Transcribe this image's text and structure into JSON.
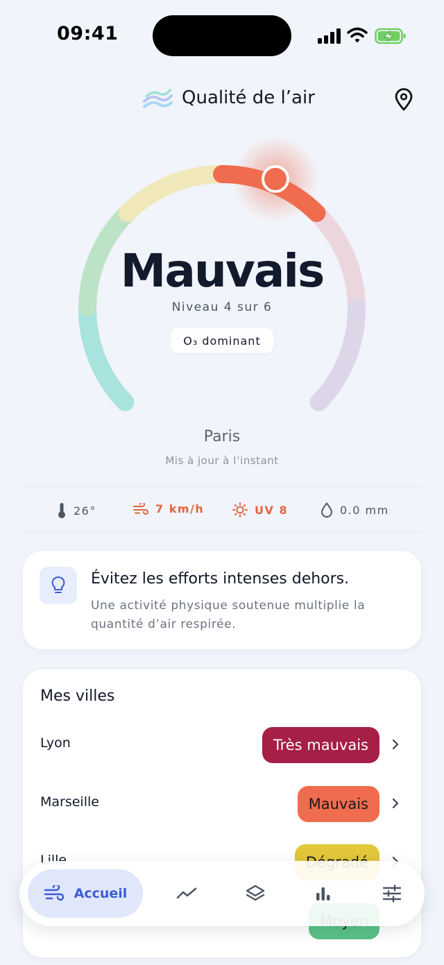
{
  "status_bar": {
    "time": "09:41"
  },
  "header": {
    "title": "Qualité de l’air"
  },
  "gauge": {
    "status": "Mauvais",
    "level_text": "Niveau 4 sur 6",
    "level": 4,
    "levels_total": 6,
    "pollutant_chip": "O₃ dominant",
    "segment_colors": [
      "#a9e3dd",
      "#bde3c7",
      "#f0e8b8",
      "#ef6c4e",
      "#ecd6de",
      "#ddd6e8"
    ],
    "accent": "#ef6c4e"
  },
  "location": {
    "city": "Paris",
    "updated": "Mis à jour à l’instant"
  },
  "weather": {
    "temperature": "26°",
    "wind": "7 km/h",
    "uv": "UV 8",
    "rain": "0.0 mm",
    "alert_color": "#e2643f"
  },
  "tip": {
    "title": "Évitez les efforts intenses dehors.",
    "body": "Une activité physique soutenue multiplie la quantité d’air respirée."
  },
  "cities": {
    "title": "Mes villes",
    "items": [
      {
        "name": "Lyon",
        "status": "Très mauvais",
        "color": "#a51f47",
        "text_color": "#ffffff"
      },
      {
        "name": "Marseille",
        "status": "Mauvais",
        "color": "#ef6c4e",
        "text_color": "#1a1a1a"
      },
      {
        "name": "Lille",
        "status": "Dégradé",
        "color": "#e3c73a",
        "text_color": "#1a1a1a"
      },
      {
        "name": "",
        "status": "Moyen",
        "color": "#59c287",
        "text_color": "#1a1a1a"
      }
    ]
  },
  "nav": {
    "home_label": "Accueil",
    "items": [
      "wind-icon",
      "trend-icon",
      "layers-icon",
      "bar-chart-icon",
      "sliders-icon"
    ]
  }
}
